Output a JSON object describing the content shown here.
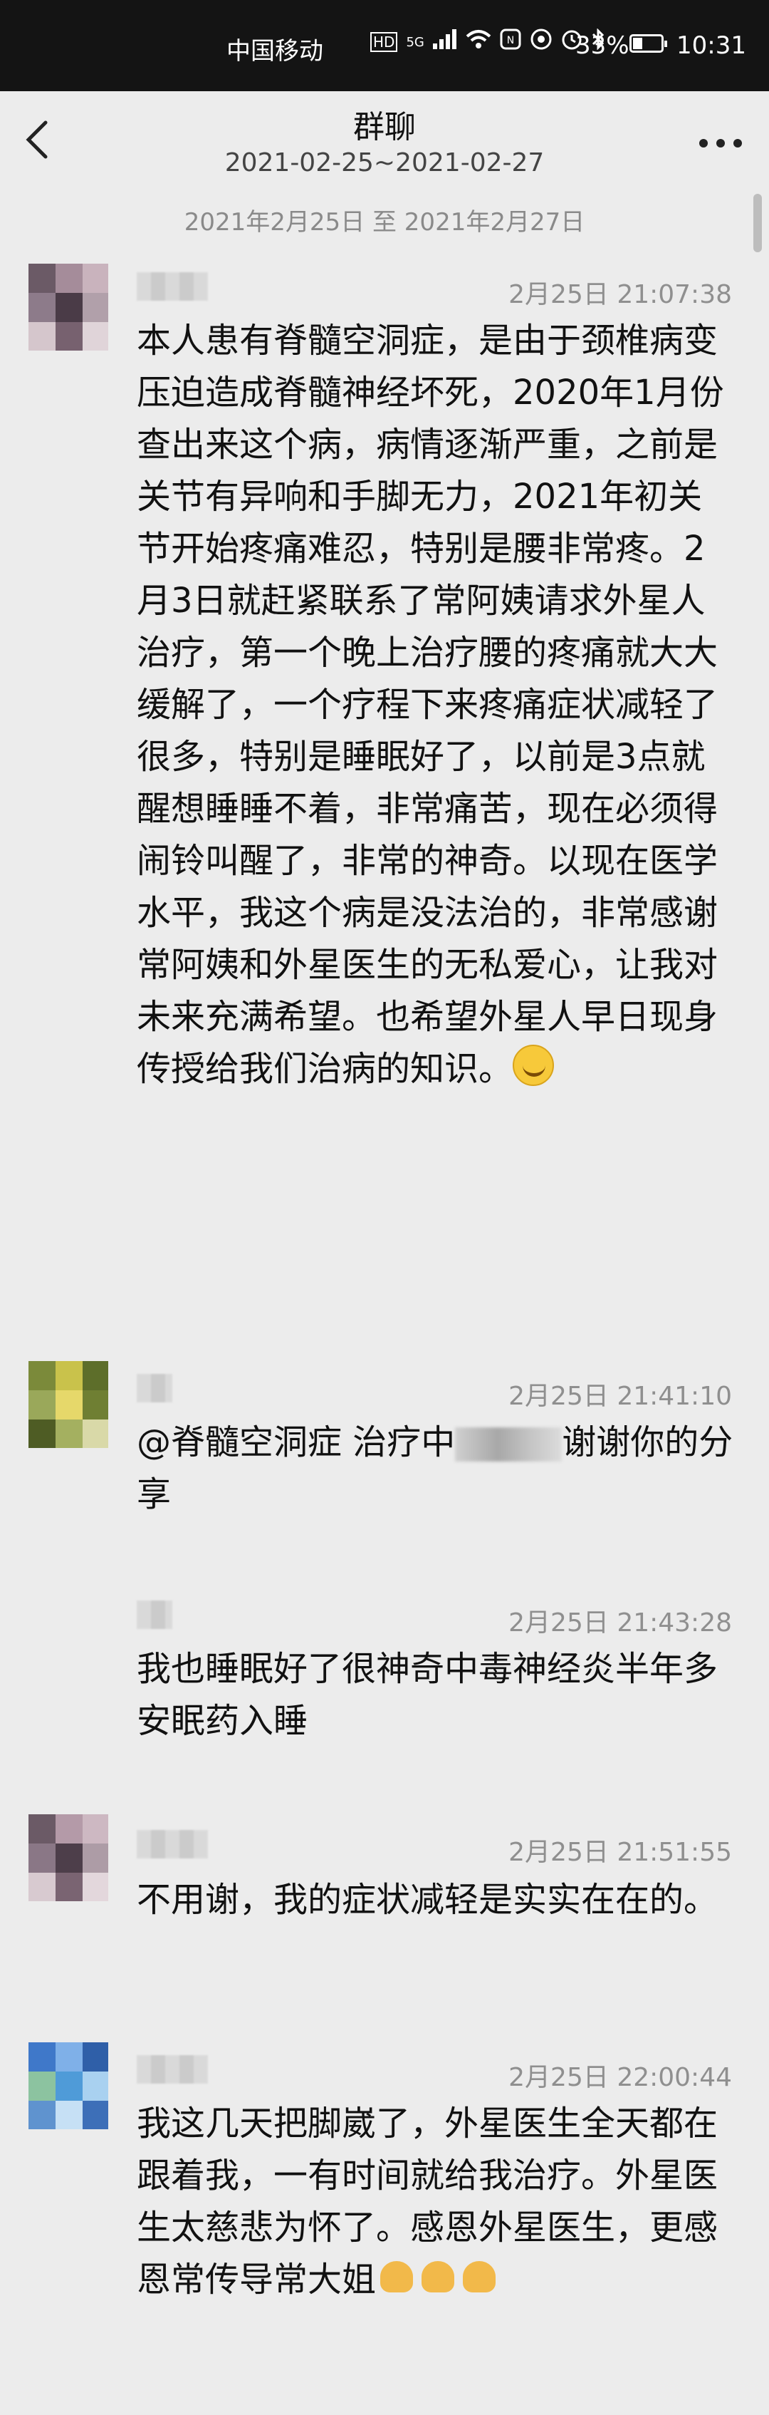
{
  "status_bar": {
    "carrier": "中国移动",
    "network_badges": [
      "HD",
      "5G"
    ],
    "icons": [
      "signal-icon",
      "wifi-icon",
      "nfc-icon",
      "eye-icon",
      "alarm-icon",
      "bluetooth-icon"
    ],
    "battery": "33%",
    "battery_level": 0.33,
    "time": "10:31"
  },
  "header": {
    "title": "群聊",
    "subtitle": "2021-02-25~2021-02-27",
    "back_icon": "chevron-left-icon",
    "more_icon": "more-horizontal-icon"
  },
  "date_range": "2021年2月25日 至 2021年2月27日",
  "messages": [
    {
      "time": "2月25日 21:07:38",
      "text": "本人患有脊髓空洞症，是由于颈椎病变压迫造成脊髓神经坏死，2020年1月份查出来这个病，病情逐渐严重，之前是关节有异响和手脚无力，2021年初关节开始疼痛难忍，特别是腰非常疼。2月3日就赶紧联系了常阿姨请求外星人治疗，第一个晚上治疗腰的疼痛就大大缓解了，一个疗程下来疼痛症状减轻了很多，特别是睡眠好了，以前是3点就醒想睡睡不着，非常痛苦，现在必须得闹铃叫醒了，非常的神奇。以现在医学水平，我这个病是没法治的，非常感谢常阿姨和外星医生的无私爱心，让我对未来充满希望。也希望外星人早日现身传授给我们治病的知识。",
      "emoji": "smile-emoji"
    },
    {
      "time": "2月25日 21:41:10",
      "text_before": "@脊髓空洞症 治疗中",
      "text_after": "谢谢你的分享"
    },
    {
      "time": "2月25日 21:43:28",
      "text": "我也睡眠好了很神奇中毒神经炎半年多安眠药入睡"
    },
    {
      "time": "2月25日 21:51:55",
      "text": "不用谢，我的症状减轻是实实在在的。"
    },
    {
      "time": "2月25日 22:00:44",
      "text": "我这几天把脚崴了，外星医生全天都在跟着我，一有时间就给我治疗。外星医生太慈悲为怀了。感恩外星医生，更感恩常传导常大姐",
      "emoji": "pray-emoji"
    }
  ]
}
